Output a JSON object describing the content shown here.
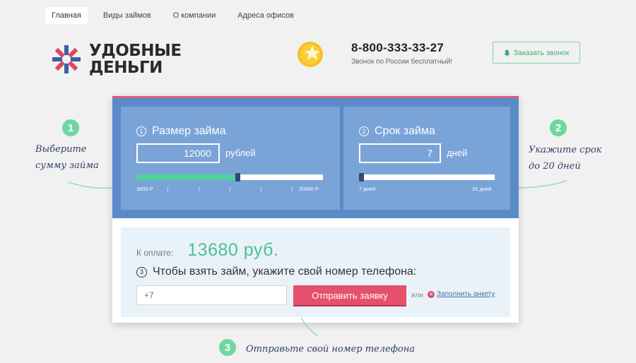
{
  "nav": {
    "items": [
      {
        "label": "Главная",
        "active": true
      },
      {
        "label": "Виды займов",
        "active": false
      },
      {
        "label": "О компании",
        "active": false
      },
      {
        "label": "Адреса офисов",
        "active": false
      }
    ]
  },
  "logo": {
    "line1": "УДОБНЫЕ",
    "line2": "ДЕНЬГИ"
  },
  "contact": {
    "phone": "8-800-333-33-27",
    "note": "Звонок по России бесплатный!"
  },
  "callback": {
    "label": "Заказать звонок",
    "icon": "bell-icon"
  },
  "amount_panel": {
    "step": "1",
    "title": "Размер займа",
    "value": "12000",
    "unit": "рублей",
    "min_label": "3000 Р",
    "max_label": "20000 Р",
    "position": 0.53
  },
  "term_panel": {
    "step": "2",
    "title": "Срок займа",
    "value": "7",
    "unit": "дней",
    "min_label": "7 дней",
    "max_label": "20 дней",
    "position": 0.0
  },
  "payment": {
    "label": "К оплате:",
    "amount": "13680 руб."
  },
  "phone_form": {
    "step": "3",
    "prompt": "Чтобы взять займ, укажите свой номер телефона:",
    "placeholder": "+7",
    "submit_label": "Отправить заявку",
    "or_label": "или",
    "alt_link": "Заполнить анкету"
  },
  "steps": {
    "step1": {
      "num": "1",
      "line1": "Выберите",
      "line2": "сумму займа"
    },
    "step2": {
      "num": "2",
      "line1": "Укажите срок",
      "line2": "до 20 дней"
    },
    "step3": {
      "num": "3",
      "text": "Отправьте свой номер телефона"
    }
  },
  "colors": {
    "accent_green": "#4cc28e",
    "card_blue": "#5b8ac9",
    "button_red": "#e5506a"
  }
}
